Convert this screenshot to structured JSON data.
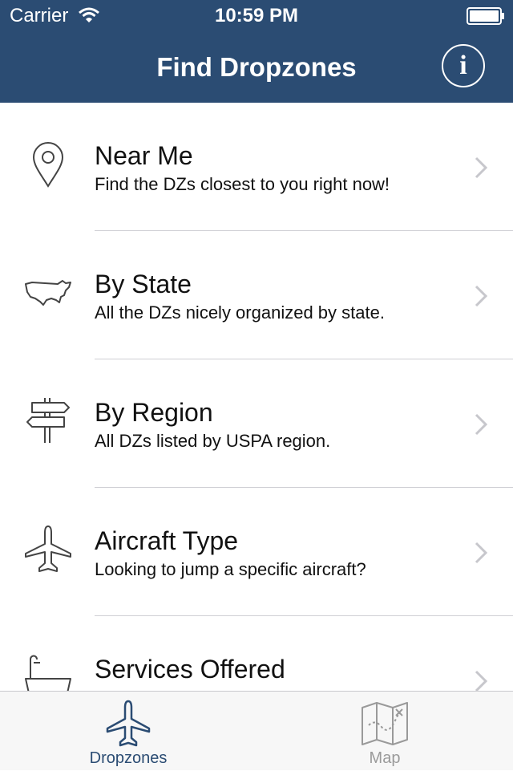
{
  "status_bar": {
    "carrier": "Carrier",
    "time": "10:59 PM",
    "wifi_icon": "wifi-icon",
    "battery_icon": "battery-icon"
  },
  "nav": {
    "title": "Find Dropzones",
    "info_label": "i",
    "info_icon": "info-icon",
    "background_color": "#2b4c73"
  },
  "list": {
    "items": [
      {
        "title": "Near Me",
        "subtitle": "Find the DZs closest to you right now!",
        "icon": "location-pin-icon"
      },
      {
        "title": "By State",
        "subtitle": "All the DZs nicely organized by state.",
        "icon": "usa-map-icon"
      },
      {
        "title": "By Region",
        "subtitle": "All DZs listed by USPA region.",
        "icon": "signpost-icon"
      },
      {
        "title": "Aircraft Type",
        "subtitle": "Looking to jump a specific aircraft?",
        "icon": "airplane-icon"
      },
      {
        "title": "Services Offered",
        "subtitle": "",
        "icon": "bathtub-icon"
      }
    ],
    "chevron_icon": "chevron-right-icon"
  },
  "tabbar": {
    "tabs": [
      {
        "label": "Dropzones",
        "icon": "airplane-icon",
        "active": true
      },
      {
        "label": "Map",
        "icon": "treasure-map-icon",
        "active": false
      }
    ],
    "active_color": "#2b4c73",
    "inactive_color": "#9a9a9a"
  }
}
